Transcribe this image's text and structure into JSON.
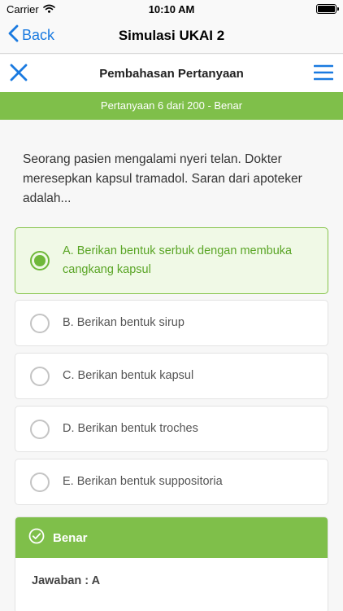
{
  "status_bar": {
    "carrier": "Carrier",
    "time": "10:10 AM"
  },
  "nav": {
    "back_label": "Back",
    "title": "Simulasi UKAI 2"
  },
  "subheader": {
    "title": "Pembahasan Pertanyaan"
  },
  "progress": {
    "text": "Pertanyaan 6 dari 200 - Benar"
  },
  "question": {
    "text": "Seorang pasien mengalami nyeri telan. Dokter meresepkan kapsul tramadol. Saran dari apoteker adalah..."
  },
  "options": [
    {
      "label": "A. Berikan bentuk serbuk dengan membuka cangkang kapsul",
      "selected": true
    },
    {
      "label": "B. Berikan bentuk sirup",
      "selected": false
    },
    {
      "label": "C. Berikan bentuk kapsul",
      "selected": false
    },
    {
      "label": "D. Berikan bentuk troches",
      "selected": false
    },
    {
      "label": "E. Berikan bentuk suppositoria",
      "selected": false
    }
  ],
  "result": {
    "status_label": "Benar",
    "answer_text": "Jawaban : A"
  },
  "colors": {
    "accent_blue": "#1a7ae0",
    "correct_green": "#7fbf4a",
    "selected_text": "#5aa526"
  },
  "icons": {
    "back": "chevron-left-icon",
    "close": "close-icon",
    "menu": "hamburger-menu-icon",
    "wifi": "wifi-icon",
    "battery": "battery-icon",
    "result": "check-circle-icon"
  }
}
